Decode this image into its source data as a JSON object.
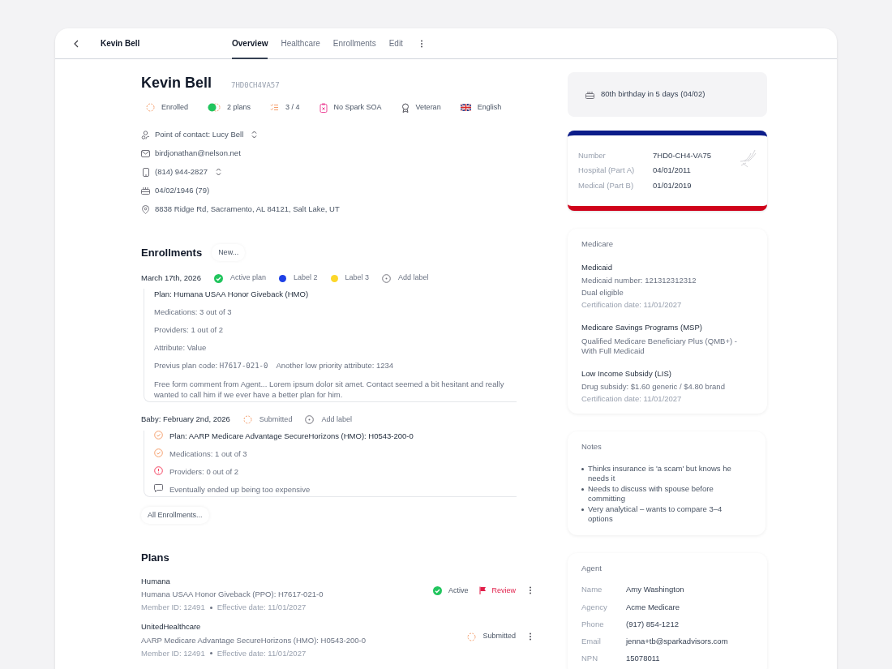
{
  "header": {
    "title": "Kevin Bell",
    "tabs": [
      {
        "label": "Overview",
        "selected": true
      },
      {
        "label": "Healthcare",
        "selected": false
      },
      {
        "label": "Enrollments",
        "selected": false
      },
      {
        "label": "Edit",
        "selected": false
      }
    ]
  },
  "profile": {
    "name": "Kevin Bell",
    "code": "7HD0CH4VA57",
    "badges": [
      {
        "kind": "enrolled",
        "label": "Enrolled"
      },
      {
        "kind": "plans",
        "label": "2 plans"
      },
      {
        "kind": "progress",
        "label": "3 / 4"
      },
      {
        "kind": "soa",
        "label": "No Spark SOA"
      },
      {
        "kind": "veteran",
        "label": "Veteran"
      },
      {
        "kind": "language",
        "label": "English"
      }
    ],
    "contacts": [
      {
        "kind": "person",
        "text": "Point of contact: Lucy Bell",
        "chooser": true
      },
      {
        "kind": "email",
        "text": "birdjonathan@nelson.net",
        "chooser": false
      },
      {
        "kind": "phone",
        "text": "(814) 944-2827",
        "chooser": true
      },
      {
        "kind": "birthday",
        "text": "04/02/1946 (79)",
        "chooser": false
      },
      {
        "kind": "location",
        "text": "8838 Ridge Rd, Sacramento, AL 84121, Salt Lake, UT",
        "chooser": false
      }
    ]
  },
  "enrollments": {
    "title": "Enrollments",
    "new_button": "New...",
    "groups": [
      {
        "date": "March 17th, 2026",
        "labels": [
          {
            "kind": "active",
            "label": "Active plan"
          },
          {
            "kind": "color",
            "label": "Label 2",
            "color": "#1e40e6"
          },
          {
            "kind": "color",
            "label": "Label 3",
            "color": "#fcd72a"
          },
          {
            "kind": "add",
            "label": "Add label"
          }
        ],
        "items": [
          {
            "kind": "plain",
            "text": "Plan: Humana USAA Honor Giveback (HMO)",
            "emphasis": true
          },
          {
            "kind": "plain",
            "text": "Medications: 3 out of 3",
            "emphasis": false
          },
          {
            "kind": "plain",
            "text": "Providers: 1 out of 2",
            "emphasis": false
          },
          {
            "kind": "plain",
            "text": "Attribute: Value",
            "emphasis": false
          },
          {
            "kind": "code",
            "text": "Previus plan code:",
            "code": "H7617-021-0",
            "extra": "Another low priority attribute: 1234",
            "emphasis": false
          },
          {
            "kind": "plain",
            "text": "Free form comment from Agent... Lorem ipsum dolor sit amet. Contact seemed a bit hesitant and really wanted to call him if we ever have a better plan for him.",
            "emphasis": false
          }
        ]
      },
      {
        "date": "Baby: February 2nd, 2026",
        "labels": [
          {
            "kind": "submitted",
            "label": "Submitted"
          },
          {
            "kind": "add",
            "label": "Add label"
          }
        ],
        "items": [
          {
            "kind": "check",
            "text": "Plan: AARP Medicare Advantage SecureHorizons (HMO): H0543-200-0",
            "emphasis": true
          },
          {
            "kind": "check",
            "text": "Medications: 1 out of 3",
            "emphasis": false
          },
          {
            "kind": "alert",
            "text": "Providers: 0 out of 2",
            "emphasis": false
          },
          {
            "kind": "comment",
            "text": "Eventually ended up being too expensive",
            "emphasis": false
          }
        ]
      }
    ],
    "all_button": "All Enrollments..."
  },
  "plans": {
    "title": "Plans",
    "rows": [
      {
        "carrier": "Humana",
        "plan": "Humana USAA Honor Giveback (PPO): H7617-021-0",
        "member_id": "Member ID: 12491",
        "effective": "Effective date: 11/01/2027",
        "status": {
          "kind": "active",
          "label": "Active"
        },
        "review": "Review"
      },
      {
        "carrier": "UnitedHealthcare",
        "plan": "AARP Medicare Advantage SecureHorizons (HMO): H0543-200-0",
        "member_id": "Member ID: 12491",
        "effective": "Effective date: 11/01/2027",
        "status": {
          "kind": "submitted",
          "label": "Submitted"
        }
      }
    ]
  },
  "birthday": {
    "text": "80th birthday in 5 days (04/02)"
  },
  "medicare_card": {
    "rows": [
      {
        "label": "Number",
        "value": "7HD0-CH4-VA75"
      },
      {
        "label": "Hospital (Part A)",
        "value": "04/01/2011"
      },
      {
        "label": "Medical (Part B)",
        "value": "01/01/2019"
      }
    ]
  },
  "medicare": {
    "title": "Medicare",
    "sections": [
      {
        "title": "Medicaid",
        "lines": [
          {
            "text": "Medicaid number: 121312312312",
            "muted": false
          },
          {
            "text": "Dual eligible",
            "muted": false
          },
          {
            "text": "Certification date: 11/01/2027",
            "muted": true
          }
        ]
      },
      {
        "title": "Medicare Savings Programs (MSP)",
        "lines": [
          {
            "text": "Qualified Medicare Beneficiary Plus (QMB+) - With Full Medicaid",
            "muted": false
          }
        ]
      },
      {
        "title": "Low Income Subsidy (LIS)",
        "lines": [
          {
            "text": "Drug subsidy: $1.60 generic / $4.80 brand",
            "muted": false
          },
          {
            "text": "Certification date: 11/01/2027",
            "muted": true
          }
        ]
      }
    ]
  },
  "notes": {
    "title": "Notes",
    "items": [
      "Thinks insurance is 'a scam' but knows he needs it",
      "Needs to discuss with spouse before committing",
      "Very analytical – wants to compare 3–4 options"
    ]
  },
  "agent": {
    "title": "Agent",
    "rows": [
      {
        "label": "Name",
        "value": "Amy Washington"
      },
      {
        "label": "Agency",
        "value": "Acme Medicare"
      },
      {
        "label": "Phone",
        "value": "(917) 854-1212"
      },
      {
        "label": "Email",
        "value": "jenna+tb@sparkadvisors.com"
      },
      {
        "label": "NPN",
        "value": "15078011"
      }
    ]
  }
}
